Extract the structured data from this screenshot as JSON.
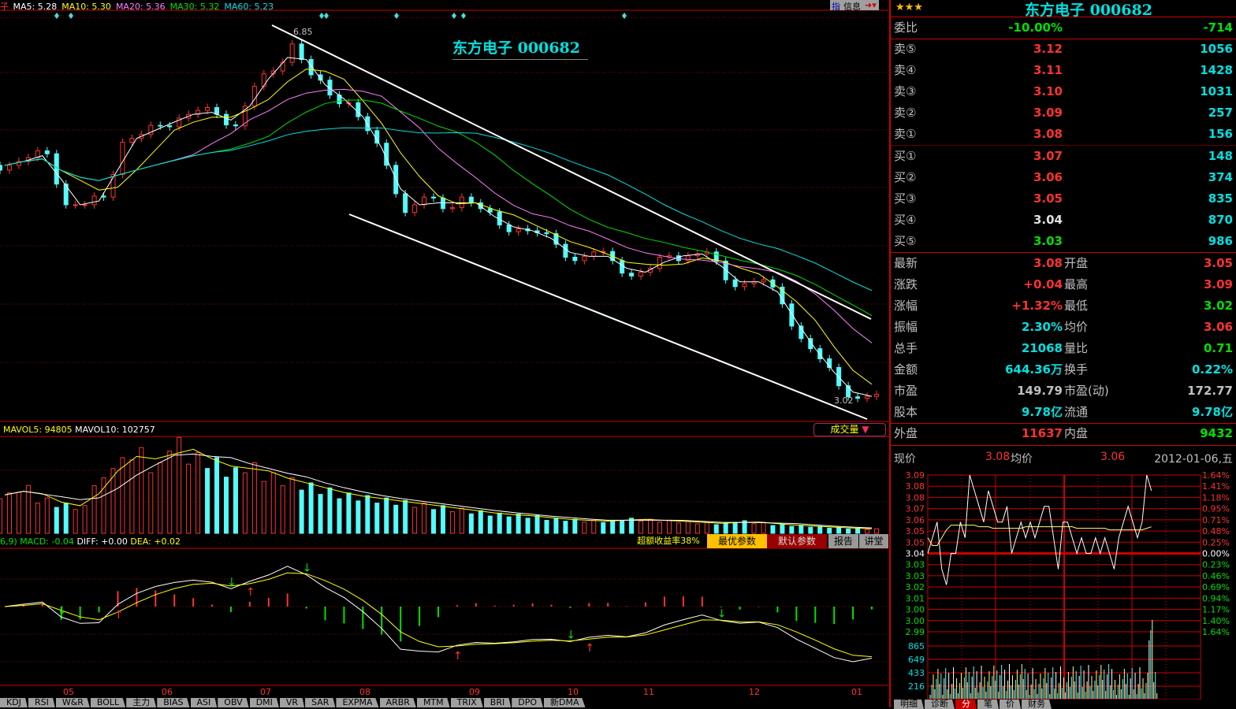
{
  "main": {
    "stock_prefix": "子",
    "ma_legend": [
      {
        "label": "MA5: 5.28",
        "color": "#ffffff"
      },
      {
        "label": "MA10: 5.30",
        "color": "#ffff00"
      },
      {
        "label": "MA20: 5.36",
        "color": "#ff80ff"
      },
      {
        "label": "MA30: 5.32",
        "color": "#00e000"
      },
      {
        "label": "MA60: 5.23",
        "color": "#00e0e0"
      }
    ],
    "chart_title": "东方电子 000682",
    "high_label": "6.85",
    "low_label": "3.02",
    "info_buttons": {
      "zhi": "指",
      "xinxi": "信息"
    }
  },
  "volume": {
    "mavol5": "MAVOL5: 94805",
    "mavol10": "MAVOL10: 102757",
    "selector": "成交量"
  },
  "macd": {
    "prefix": "6,9)",
    "macd": "MACD: -0.04",
    "diff": "DIFF: +0.00",
    "dea": "DEA: +0.02",
    "excess": "超额收益率38%",
    "best": "最优参数",
    "default": "默认参数",
    "report": "报告",
    "lecture": "讲堂"
  },
  "date_axis": [
    "05",
    "06",
    "07",
    "08",
    "09",
    "10",
    "11",
    "12",
    "01"
  ],
  "indicator_tabs": [
    "KDJ",
    "RSI",
    "W&R",
    "BOLL",
    "主力",
    "BIAS",
    "ASI",
    "OBV",
    "DMI",
    "VR",
    "SAR",
    "EXPMA",
    "ARBR",
    "MTM",
    "TRIX",
    "BRI",
    "DPO",
    "新DMA"
  ],
  "chart_data": {
    "type": "candlestick",
    "closes": [
      5.46,
      5.54,
      5.58,
      5.05,
      5.05,
      5.13,
      5.7,
      5.78,
      5.87,
      5.95,
      6.03,
      5.99,
      5.87,
      6.28,
      6.44,
      6.72,
      6.4,
      6.19,
      6.11,
      5.82,
      5.46,
      4.97,
      5.13,
      5.01,
      5.13,
      5.01,
      4.84,
      4.8,
      4.76,
      4.64,
      4.47,
      4.56,
      4.47,
      4.31,
      4.39,
      4.52,
      4.52,
      4.56,
      4.27,
      4.23,
      4.27,
      4.02,
      3.66,
      3.45,
      3.17,
      3.04,
      3.08
    ],
    "volumes": [
      80,
      95,
      70,
      60,
      55,
      110,
      150,
      170,
      140,
      190,
      160,
      150,
      130,
      140,
      120,
      110,
      100,
      90,
      80,
      75,
      70,
      65,
      60,
      55,
      50,
      45,
      40,
      38,
      35,
      30,
      28,
      26,
      25,
      30,
      28,
      26,
      24,
      22,
      20,
      25,
      22,
      18,
      16,
      14,
      12,
      10,
      9
    ],
    "series": [
      "MA5",
      "MA10",
      "MA20",
      "MA30",
      "MA60"
    ],
    "price_high": 6.85,
    "price_low": 3.02
  },
  "quote": {
    "title": "东方电子 000682",
    "weibi": {
      "label": "委比",
      "pct": "-10.00%",
      "val": "-714"
    },
    "sell": [
      {
        "label": "卖⑤",
        "price": "3.12",
        "vol": "1056"
      },
      {
        "label": "卖④",
        "price": "3.11",
        "vol": "1428"
      },
      {
        "label": "卖③",
        "price": "3.10",
        "vol": "1031"
      },
      {
        "label": "卖②",
        "price": "3.09",
        "vol": "257"
      },
      {
        "label": "卖①",
        "price": "3.08",
        "vol": "156"
      }
    ],
    "buy": [
      {
        "label": "买①",
        "price": "3.07",
        "vol": "148",
        "c": "red"
      },
      {
        "label": "买②",
        "price": "3.06",
        "vol": "374",
        "c": "red"
      },
      {
        "label": "买③",
        "price": "3.05",
        "vol": "835",
        "c": "red"
      },
      {
        "label": "买④",
        "price": "3.04",
        "vol": "870",
        "c": "wht"
      },
      {
        "label": "买⑤",
        "price": "3.03",
        "vol": "986",
        "c": "grn"
      }
    ],
    "stats": [
      {
        "l": "最新",
        "v": "3.08",
        "vc": "red",
        "l2": "开盘",
        "v2": "3.05",
        "v2c": "red"
      },
      {
        "l": "涨跌",
        "v": "+0.04",
        "vc": "red",
        "l2": "最高",
        "v2": "3.09",
        "v2c": "red"
      },
      {
        "l": "涨幅",
        "v": "+1.32%",
        "vc": "red",
        "l2": "最低",
        "v2": "3.02",
        "v2c": "grn"
      },
      {
        "l": "振幅",
        "v": "2.30%",
        "vc": "cyn",
        "l2": "均价",
        "v2": "3.06",
        "v2c": "red"
      },
      {
        "l": "总手",
        "v": "21068",
        "vc": "cyn",
        "l2": "量比",
        "v2": "0.71",
        "v2c": "grn"
      },
      {
        "l": "金额",
        "v": "644.36万",
        "vc": "cyn",
        "l2": "换手",
        "v2": "0.22%",
        "v2c": "cyn"
      },
      {
        "l": "市盈",
        "v": "149.79",
        "vc": "gry",
        "l2": "市盈(动)",
        "v2": "172.77",
        "v2c": "gry"
      },
      {
        "l": "股本",
        "v": "9.78亿",
        "vc": "cyn",
        "l2": "流通",
        "v2": "9.78亿",
        "v2c": "cyn"
      }
    ],
    "waipan": {
      "l": "外盘",
      "v": "11637",
      "l2": "内盘",
      "v2": "9432"
    }
  },
  "minute": {
    "now_label": "现价",
    "now": "3.08",
    "avg_label": "均价",
    "avg": "3.06",
    "date": "2012-01-06,五",
    "price_ticks": [
      "3.09",
      "3.08",
      "3.08",
      "3.07",
      "3.06",
      "3.05",
      "3.05",
      "3.04",
      "3.03",
      "3.03",
      "3.02",
      "3.01",
      "3.00",
      "3.00",
      "2.99"
    ],
    "pct_ticks": [
      "1.64%",
      "1.41%",
      "1.18%",
      "0.95%",
      "0.71%",
      "0.48%",
      "0.25%",
      "0.00%",
      "0.23%",
      "0.46%",
      "0.69%",
      "0.94%",
      "1.17%",
      "1.40%",
      "1.64%"
    ],
    "vol_ticks": [
      "865",
      "649",
      "433",
      "216"
    ],
    "prices": [
      3.04,
      3.05,
      3.06,
      3.03,
      3.02,
      3.04,
      3.04,
      3.06,
      3.05,
      3.09,
      3.08,
      3.07,
      3.06,
      3.08,
      3.07,
      3.06,
      3.06,
      3.07,
      3.04,
      3.05,
      3.06,
      3.05,
      3.06,
      3.05,
      3.06,
      3.07,
      3.07,
      3.05,
      3.03,
      3.06,
      3.06,
      3.05,
      3.04,
      3.05,
      3.04,
      3.04,
      3.05,
      3.04,
      3.05,
      3.04,
      3.03,
      3.05,
      3.06,
      3.07,
      3.06,
      3.05,
      3.06,
      3.09,
      3.08
    ],
    "avg_prices": [
      3.05,
      3.045,
      3.045,
      3.05,
      3.055,
      3.058,
      3.058,
      3.058,
      3.058,
      3.058,
      3.058,
      3.057,
      3.057,
      3.057,
      3.056,
      3.056,
      3.056,
      3.056,
      3.056,
      3.056,
      3.056,
      3.057,
      3.057,
      3.057,
      3.057,
      3.057,
      3.057,
      3.057,
      3.057,
      3.057,
      3.057,
      3.057,
      3.056,
      3.056,
      3.056,
      3.056,
      3.056,
      3.056,
      3.056,
      3.055,
      3.055,
      3.055,
      3.055,
      3.055,
      3.055,
      3.055,
      3.055,
      3.056,
      3.057
    ],
    "tabs": [
      "明细",
      "诊断",
      "分",
      "笔",
      "价",
      "财务"
    ]
  }
}
